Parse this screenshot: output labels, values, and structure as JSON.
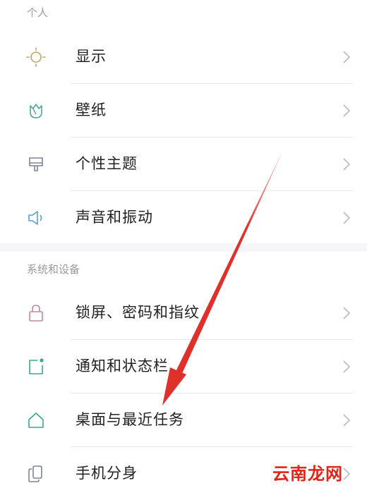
{
  "sections": {
    "personal": "个人",
    "system": "系统和设备"
  },
  "personal_items": [
    {
      "label": "显示",
      "icon": "brightness-icon",
      "color": "#c9a36a"
    },
    {
      "label": "壁纸",
      "icon": "wallpaper-tulip-icon",
      "color": "#4fa89a"
    },
    {
      "label": "个性主题",
      "icon": "theme-brush-icon",
      "color": "#7a8694"
    },
    {
      "label": "声音和振动",
      "icon": "speaker-icon",
      "color": "#5aa0c8"
    }
  ],
  "system_items": [
    {
      "label": "锁屏、密码和指纹",
      "icon": "lock-icon",
      "color": "#c9869a"
    },
    {
      "label": "通知和状态栏",
      "icon": "notification-icon",
      "color": "#3aa88a"
    },
    {
      "label": "桌面与最近任务",
      "icon": "home-icon",
      "color": "#3aa88a"
    },
    {
      "label": "手机分身",
      "icon": "dual-phone-icon",
      "color": "#7a8694"
    }
  ],
  "annotation": {
    "arrow_color": "#e0302b"
  },
  "watermark": "云南龙网"
}
